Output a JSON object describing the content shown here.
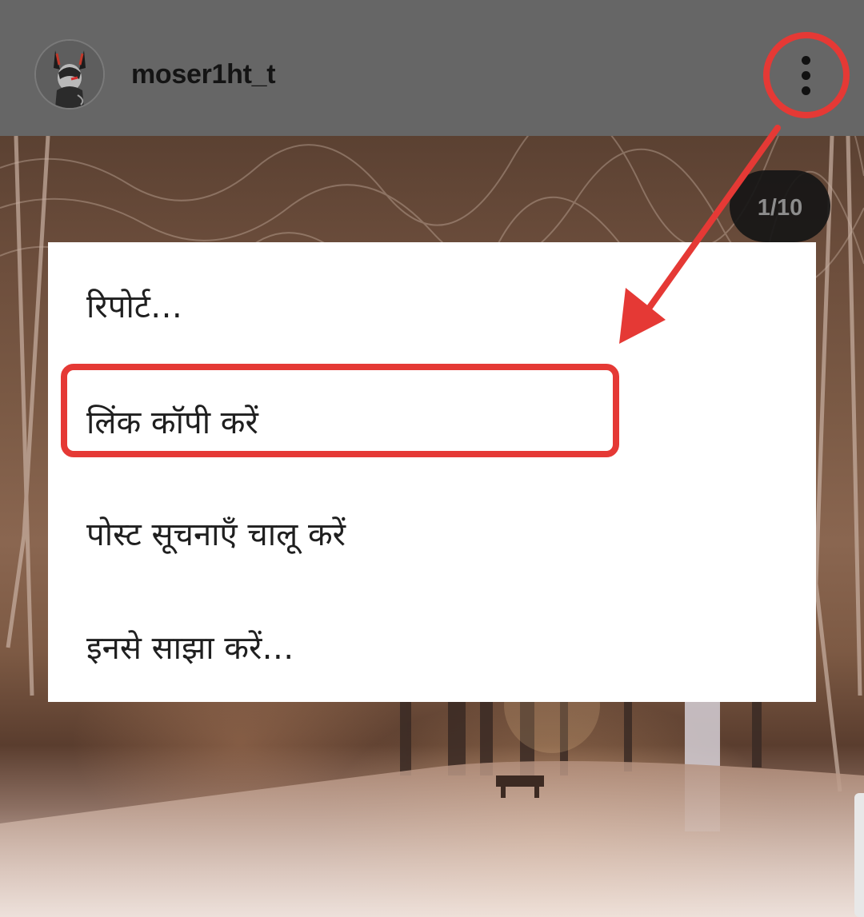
{
  "header": {
    "username": "moser1ht_t",
    "avatar_icon": "avatar-horned-character-icon",
    "more_icon": "more-vertical-icon"
  },
  "post": {
    "slide_counter": "1/10",
    "current_slide": 1,
    "total_slides": 10
  },
  "menu": {
    "items": [
      {
        "label": "रिपोर्ट…"
      },
      {
        "label": "लिंक कॉपी करें"
      },
      {
        "label": "पोस्ट सूचनाएँ चालू करें"
      },
      {
        "label": "इनसे साझा करें…"
      }
    ]
  },
  "annotations": {
    "color": "#e53935",
    "highlighted_item": "लिंक कॉपी करें"
  },
  "colors": {
    "header_bg": "#666666",
    "menu_bg": "#ffffff",
    "counter_bg": "#161616",
    "annotation": "#e53935"
  }
}
